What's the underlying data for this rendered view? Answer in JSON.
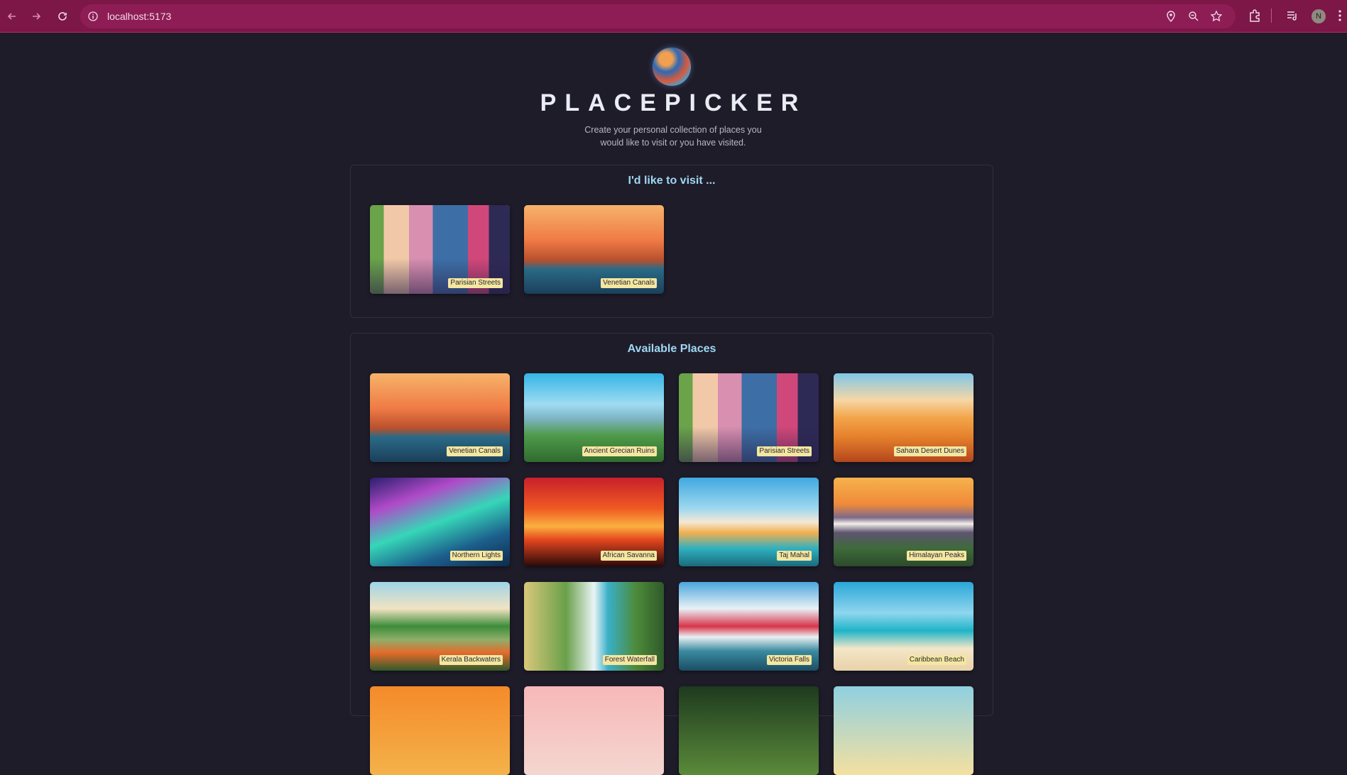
{
  "browser": {
    "url": "localhost:5173",
    "profile_initial": "N",
    "icons": [
      "back-arrow-icon",
      "forward-arrow-icon",
      "reload-icon",
      "site-info-icon",
      "location-icon",
      "zoom-icon",
      "bookmark-star-icon",
      "extensions-icon",
      "media-queue-icon",
      "menu-dots-icon"
    ]
  },
  "header": {
    "title": "PLACEPICKER",
    "subtitle": "Create your personal collection of places you would like to visit or you have visited."
  },
  "wishlist": {
    "title": "I'd like to visit ...",
    "places": [
      {
        "name": "Parisian Streets"
      },
      {
        "name": "Venetian Canals"
      }
    ]
  },
  "available": {
    "title": "Available Places",
    "places": [
      {
        "name": "Venetian Canals"
      },
      {
        "name": "Ancient Grecian Ruins"
      },
      {
        "name": "Parisian Streets"
      },
      {
        "name": "Sahara Desert Dunes"
      },
      {
        "name": "Northern Lights"
      },
      {
        "name": "African Savanna"
      },
      {
        "name": "Taj Mahal"
      },
      {
        "name": "Himalayan Peaks"
      },
      {
        "name": "Kerala Backwaters"
      },
      {
        "name": "Forest Waterfall"
      },
      {
        "name": "Victoria Falls"
      },
      {
        "name": "Caribbean Beach"
      }
    ]
  },
  "colors": {
    "chrome": "#7c1748",
    "background": "#1f1c2a",
    "section_title": "#9ed8f0",
    "label_bg": "#f4e7a0"
  }
}
